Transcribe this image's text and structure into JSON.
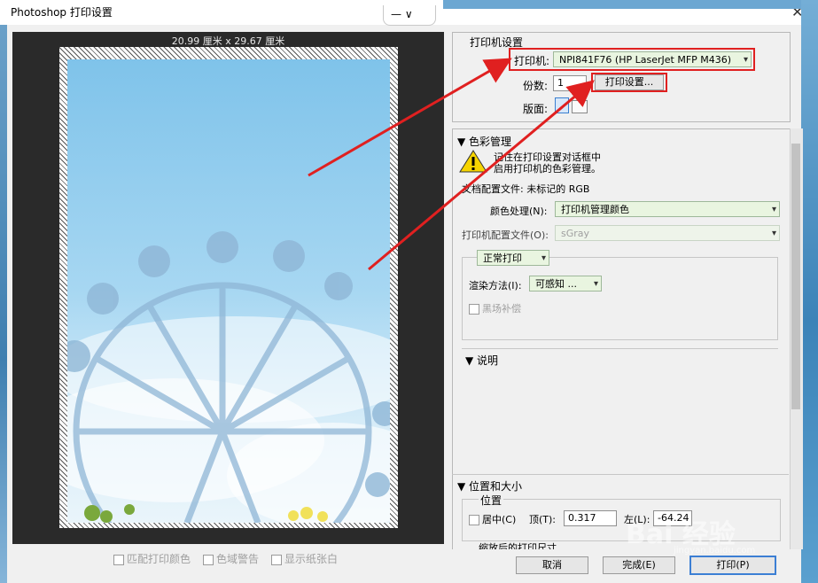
{
  "window": {
    "title": "Photoshop 打印设置",
    "close_glyph": "✕",
    "ctrl_glyphs": "— ∨"
  },
  "preview": {
    "size_label": "20.99 厘米 x 29.67 厘米"
  },
  "printer_setup": {
    "section_title": "打印机设置",
    "printer_label": "打印机:",
    "printer_value": "NPI841F76 (HP LaserJet MFP M436)",
    "copies_label": "份数:",
    "copies_value": "1",
    "print_settings_button": "打印设置...",
    "layout_label": "版面:"
  },
  "color_management": {
    "section_title": "色彩管理",
    "warning_line1": "记住在打印设置对话框中",
    "warning_line2": "启用打印机的色彩管理。",
    "doc_profile": "文档配置文件: 未标记的 RGB",
    "color_handling_label": "颜色处理(N):",
    "color_handling_value": "打印机管理颜色",
    "printer_profile_label": "打印机配置文件(O):",
    "printer_profile_value": "sGray",
    "mode_value": "正常打印",
    "rendering_label": "渲染方法(I):",
    "rendering_value": "可感知",
    "rendering_more": "...",
    "bpc_label": "黑场补偿"
  },
  "description": {
    "section_title": "说明"
  },
  "position_size": {
    "section_title": "位置和大小",
    "group_title": "位置",
    "center_label": "居中(C)",
    "top_label": "顶(T):",
    "top_value": "0.317",
    "left_label": "左(L):",
    "left_value": "-64.24",
    "scaled_title": "缩放后的打印尺寸"
  },
  "bottom_options": {
    "match_colors": "匹配打印颜色",
    "gamut_warning": "色域警告",
    "show_paper_white": "显示纸张白"
  },
  "buttons": {
    "cancel": "取消",
    "done": "完成(E)",
    "print": "打印(P)"
  },
  "watermark": {
    "text": "Bai 经验",
    "url": "jingyan.baidu.com"
  },
  "colors": {
    "highlight_red": "#e02020",
    "select_green": "#e9f5e0"
  }
}
